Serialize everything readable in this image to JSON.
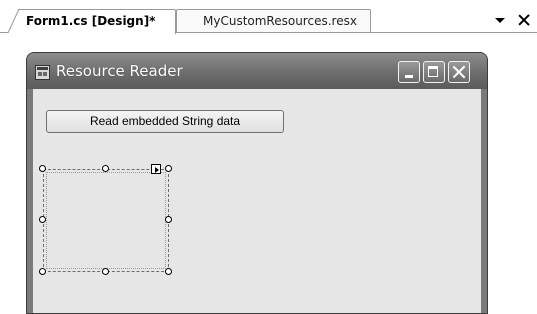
{
  "tabs": [
    {
      "label": "Form1.cs [Design]*",
      "active": true
    },
    {
      "label": "MyCustomResources.resx",
      "active": false
    }
  ],
  "tab_tools": {
    "dropdown_icon": "dropdown-arrow-icon",
    "close_icon": "close-icon"
  },
  "window": {
    "title": "Resource Reader",
    "icon": "form-icon",
    "buttons": [
      "minimize-icon",
      "maximize-icon",
      "close-icon"
    ]
  },
  "form": {
    "read_button_label": "Read embedded String data",
    "picture_box": {
      "selected": true,
      "smart_tag_icon": "smart-tag-arrow-icon"
    }
  },
  "colors": {
    "titlebar": "#6d6d6d",
    "form_background": "#e6e6e6"
  }
}
